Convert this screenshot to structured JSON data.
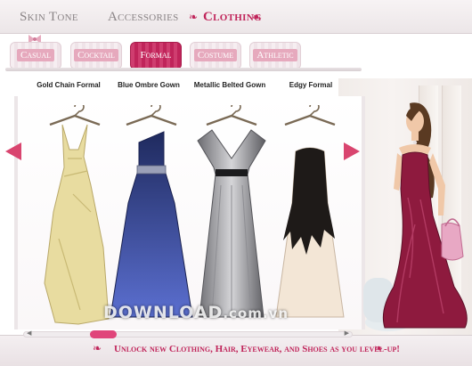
{
  "top_tabs": [
    {
      "label": "Skin Tone"
    },
    {
      "label": "Accessories"
    },
    {
      "label": "Clothing",
      "active": true
    }
  ],
  "categories": [
    {
      "label": "Casual"
    },
    {
      "label": "Cocktail"
    },
    {
      "label": "Formal",
      "active": true
    },
    {
      "label": "Costume"
    },
    {
      "label": "Athletic"
    }
  ],
  "dresses": [
    {
      "name": "Gold Chain Formal",
      "color": "#e8dca0"
    },
    {
      "name": "Blue Ombre Gown",
      "color": "#2f3f8c"
    },
    {
      "name": "Metallic Belted Gown",
      "color": "#a9a9ad"
    },
    {
      "name": "Edgy Formal",
      "color": "#1e1a18"
    }
  ],
  "footer": {
    "message": "Unlock new Clothing, Hair, Eyewear, and Shoes as you level-up!"
  },
  "watermark": {
    "text": "DOWNLOAD",
    "suffix": ".com.vn"
  },
  "colors": {
    "accent": "#c0245a",
    "arrow": "#d9456f",
    "model_gown": "#8e1a3e"
  },
  "icons": {
    "tab_left": "flourish-icon",
    "tab_right": "flourish-icon",
    "prev": "arrow-left-icon",
    "next": "arrow-right-icon"
  }
}
